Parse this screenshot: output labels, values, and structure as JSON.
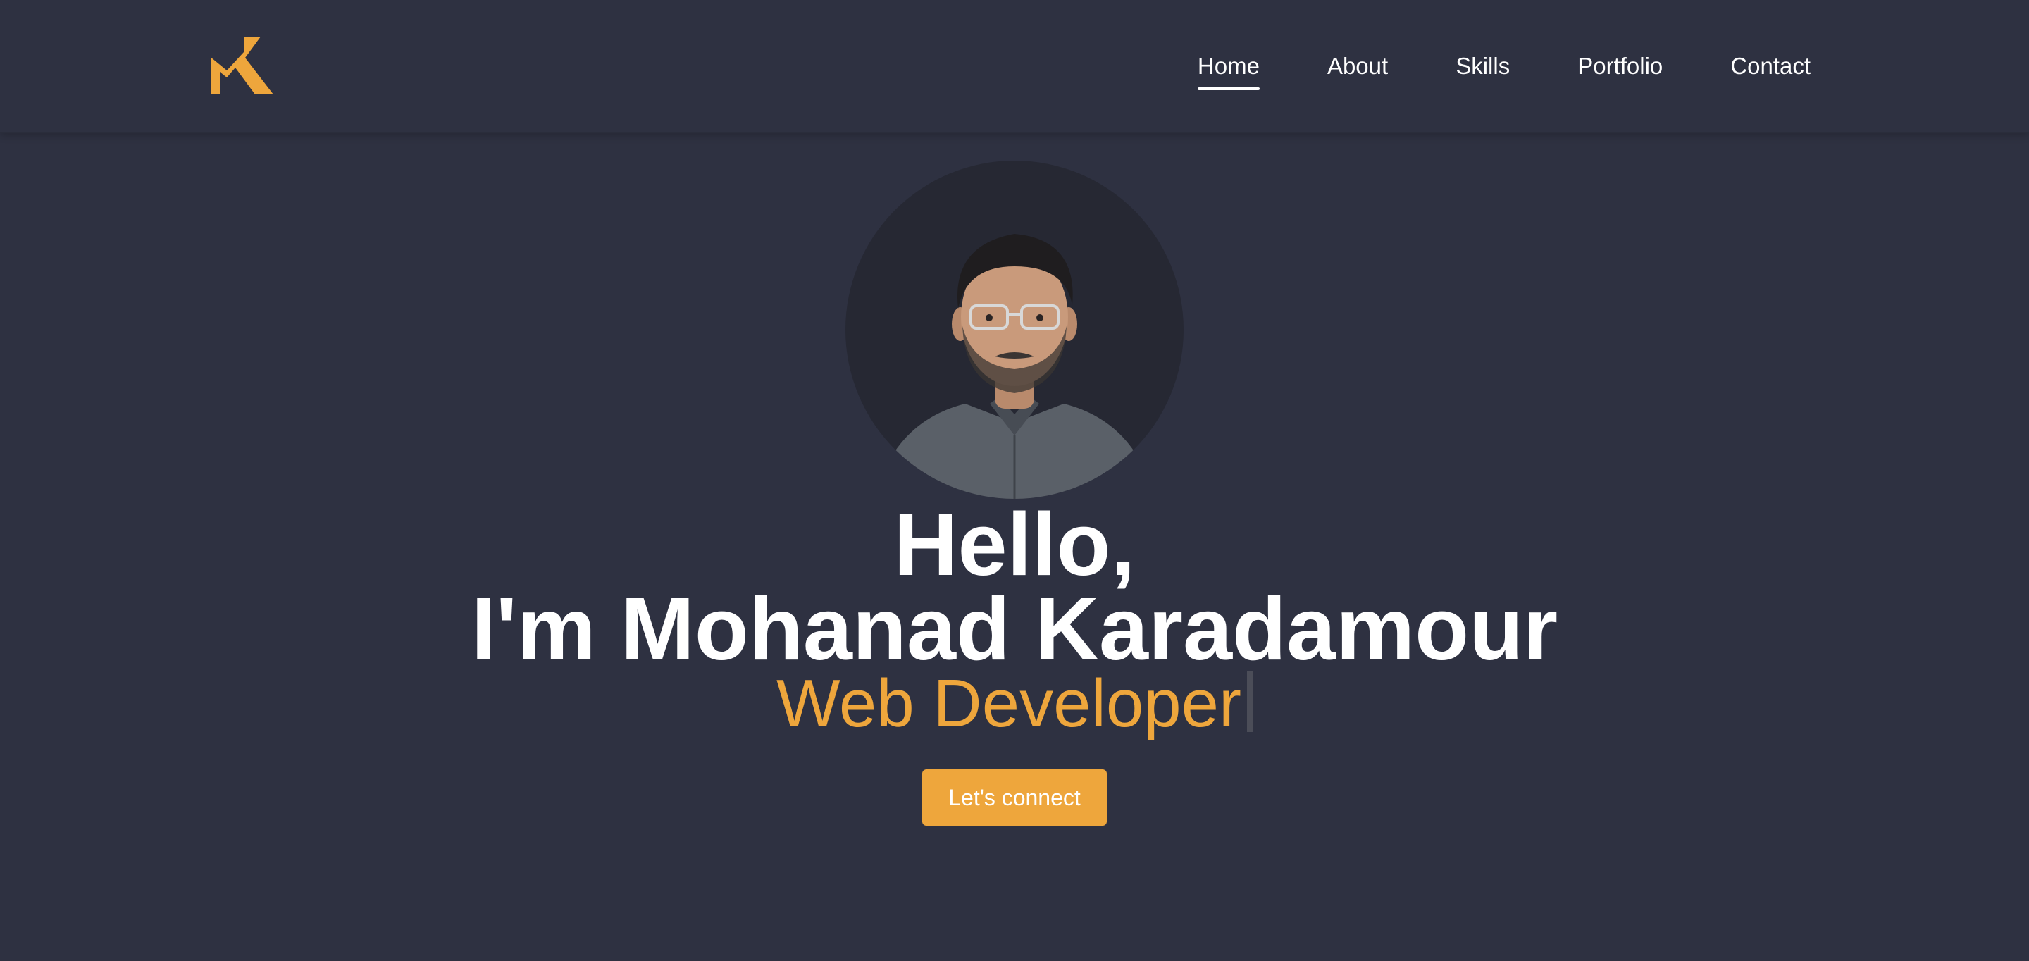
{
  "brand": {
    "logo_icon": "mk-monogram-logo",
    "accent_color": "#eea63c"
  },
  "nav": {
    "items": [
      {
        "label": "Home",
        "active": true
      },
      {
        "label": "About",
        "active": false
      },
      {
        "label": "Skills",
        "active": false
      },
      {
        "label": "Portfolio",
        "active": false
      },
      {
        "label": "Contact",
        "active": false
      }
    ]
  },
  "hero": {
    "avatar_icon": "profile-photo",
    "greeting": "Hello,",
    "name_line": "I'm Mohanad Karadamour",
    "role": "Web Developer",
    "cta_label": "Let's connect"
  },
  "colors": {
    "background": "#2e3141",
    "text": "#ffffff",
    "accent": "#eea63c"
  }
}
